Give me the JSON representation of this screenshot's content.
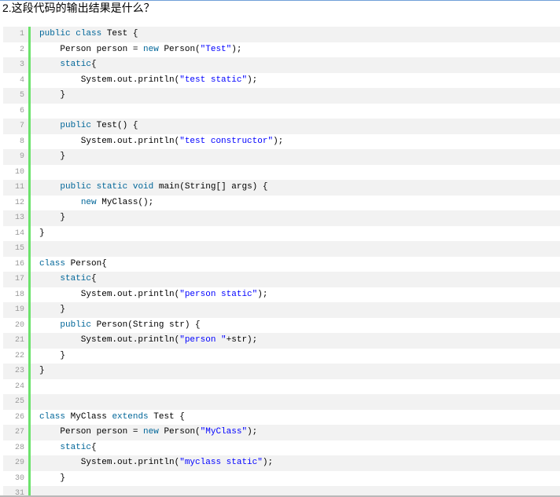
{
  "question": "2.这段代码的输出结果是什么？",
  "code_lines": [
    {
      "n": "1",
      "tokens": [
        {
          "t": "public",
          "k": "kw"
        },
        {
          "t": " "
        },
        {
          "t": "class",
          "k": "kw"
        },
        {
          "t": " Test {"
        }
      ]
    },
    {
      "n": "2",
      "tokens": [
        {
          "t": "    Person person = "
        },
        {
          "t": "new",
          "k": "kw"
        },
        {
          "t": " Person("
        },
        {
          "t": "\"Test\"",
          "k": "str"
        },
        {
          "t": ");"
        }
      ]
    },
    {
      "n": "3",
      "tokens": [
        {
          "t": "    "
        },
        {
          "t": "static",
          "k": "kw"
        },
        {
          "t": "{"
        }
      ]
    },
    {
      "n": "4",
      "tokens": [
        {
          "t": "        System.out.println("
        },
        {
          "t": "\"test static\"",
          "k": "str"
        },
        {
          "t": ");"
        }
      ]
    },
    {
      "n": "5",
      "tokens": [
        {
          "t": "    }"
        }
      ]
    },
    {
      "n": "6",
      "tokens": [
        {
          "t": ""
        }
      ]
    },
    {
      "n": "7",
      "tokens": [
        {
          "t": "    "
        },
        {
          "t": "public",
          "k": "kw"
        },
        {
          "t": " Test() {"
        }
      ]
    },
    {
      "n": "8",
      "tokens": [
        {
          "t": "        System.out.println("
        },
        {
          "t": "\"test constructor\"",
          "k": "str"
        },
        {
          "t": ");"
        }
      ]
    },
    {
      "n": "9",
      "tokens": [
        {
          "t": "    }"
        }
      ]
    },
    {
      "n": "10",
      "tokens": [
        {
          "t": ""
        }
      ]
    },
    {
      "n": "11",
      "tokens": [
        {
          "t": "    "
        },
        {
          "t": "public",
          "k": "kw"
        },
        {
          "t": " "
        },
        {
          "t": "static",
          "k": "kw"
        },
        {
          "t": " "
        },
        {
          "t": "void",
          "k": "kw"
        },
        {
          "t": " main(String[] args) {"
        }
      ]
    },
    {
      "n": "12",
      "tokens": [
        {
          "t": "        "
        },
        {
          "t": "new",
          "k": "kw"
        },
        {
          "t": " MyClass();"
        }
      ]
    },
    {
      "n": "13",
      "tokens": [
        {
          "t": "    }"
        }
      ]
    },
    {
      "n": "14",
      "tokens": [
        {
          "t": "}"
        }
      ]
    },
    {
      "n": "15",
      "tokens": [
        {
          "t": ""
        }
      ]
    },
    {
      "n": "16",
      "tokens": [
        {
          "t": "class",
          "k": "kw"
        },
        {
          "t": " Person{"
        }
      ]
    },
    {
      "n": "17",
      "tokens": [
        {
          "t": "    "
        },
        {
          "t": "static",
          "k": "kw"
        },
        {
          "t": "{"
        }
      ]
    },
    {
      "n": "18",
      "tokens": [
        {
          "t": "        System.out.println("
        },
        {
          "t": "\"person static\"",
          "k": "str"
        },
        {
          "t": ");"
        }
      ]
    },
    {
      "n": "19",
      "tokens": [
        {
          "t": "    }"
        }
      ]
    },
    {
      "n": "20",
      "tokens": [
        {
          "t": "    "
        },
        {
          "t": "public",
          "k": "kw"
        },
        {
          "t": " Person(String str) {"
        }
      ]
    },
    {
      "n": "21",
      "tokens": [
        {
          "t": "        System.out.println("
        },
        {
          "t": "\"person \"",
          "k": "str"
        },
        {
          "t": "+str);"
        }
      ]
    },
    {
      "n": "22",
      "tokens": [
        {
          "t": "    }"
        }
      ]
    },
    {
      "n": "23",
      "tokens": [
        {
          "t": "}"
        }
      ]
    },
    {
      "n": "24",
      "tokens": [
        {
          "t": ""
        }
      ]
    },
    {
      "n": "25",
      "tokens": [
        {
          "t": ""
        }
      ]
    },
    {
      "n": "26",
      "tokens": [
        {
          "t": "class",
          "k": "kw"
        },
        {
          "t": " MyClass "
        },
        {
          "t": "extends",
          "k": "kw"
        },
        {
          "t": " Test {"
        }
      ]
    },
    {
      "n": "27",
      "tokens": [
        {
          "t": "    Person person = "
        },
        {
          "t": "new",
          "k": "kw"
        },
        {
          "t": " Person("
        },
        {
          "t": "\"MyClass\"",
          "k": "str"
        },
        {
          "t": ");"
        }
      ]
    },
    {
      "n": "28",
      "tokens": [
        {
          "t": "    "
        },
        {
          "t": "static",
          "k": "kw"
        },
        {
          "t": "{"
        }
      ]
    },
    {
      "n": "29",
      "tokens": [
        {
          "t": "        System.out.println("
        },
        {
          "t": "\"myclass static\"",
          "k": "str"
        },
        {
          "t": ");"
        }
      ]
    },
    {
      "n": "30",
      "tokens": [
        {
          "t": "    }"
        }
      ]
    },
    {
      "n": "31",
      "tokens": [
        {
          "t": ""
        }
      ]
    }
  ],
  "colors": {
    "keyword": "#006699",
    "string": "#0000ff",
    "gutter_bar": "#6ce26c",
    "line_number": "#9a9a9a"
  }
}
